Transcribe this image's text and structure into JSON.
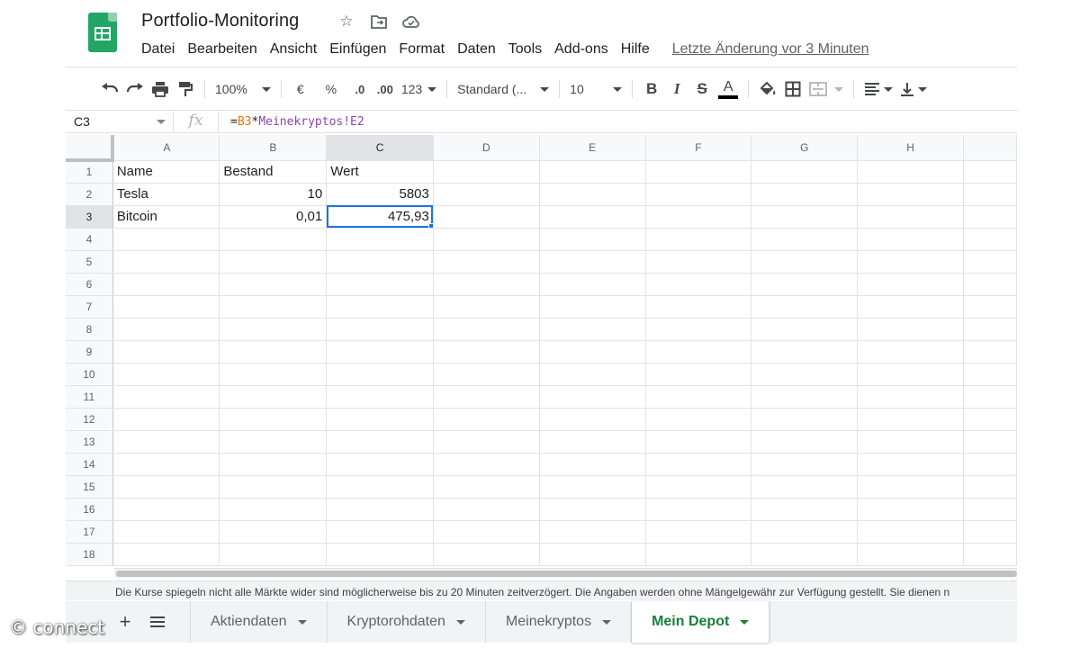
{
  "app": {
    "doc_title": "Portfolio-Monitoring",
    "last_edit": "Letzte Änderung vor 3 Minuten",
    "brand_color": "#188038",
    "logo_color": "#23a566"
  },
  "title_icons": [
    "star-icon",
    "move-to-folder-icon",
    "cloud-status-icon"
  ],
  "menu": [
    "Datei",
    "Bearbeiten",
    "Ansicht",
    "Einfügen",
    "Format",
    "Daten",
    "Tools",
    "Add-ons",
    "Hilfe"
  ],
  "toolbar": {
    "zoom": "100%",
    "currency": "€",
    "percent": "%",
    "decrease_decimals": ".0",
    "increase_decimals": ".00",
    "more_formats": "123",
    "font_name": "Standard (...",
    "font_size": "10",
    "bold": "B",
    "italic": "I",
    "strikethrough": "S",
    "text_color": "A"
  },
  "formula_bar": {
    "cell_ref": "C3",
    "fx": "fx",
    "formula_prefix": "=",
    "formula_ref1": "B3",
    "formula_op": "*",
    "formula_ref2": "Meinekryptos!E2"
  },
  "sheet": {
    "columns": [
      "A",
      "B",
      "C",
      "D",
      "E",
      "F",
      "G",
      "H"
    ],
    "active_column": "C",
    "active_row": 3,
    "rows": [
      {
        "n": "1",
        "cells": [
          "Name",
          "Bestand",
          "Wert",
          "",
          "",
          "",
          "",
          ""
        ]
      },
      {
        "n": "2",
        "cells": [
          "Tesla",
          "10",
          "5803",
          "",
          "",
          "",
          "",
          ""
        ]
      },
      {
        "n": "3",
        "cells": [
          "Bitcoin",
          "0,01",
          "475,93",
          "",
          "",
          "",
          "",
          ""
        ]
      },
      {
        "n": "4",
        "cells": [
          "",
          "",
          "",
          "",
          "",
          "",
          "",
          ""
        ]
      },
      {
        "n": "5",
        "cells": [
          "",
          "",
          "",
          "",
          "",
          "",
          "",
          ""
        ]
      },
      {
        "n": "6",
        "cells": [
          "",
          "",
          "",
          "",
          "",
          "",
          "",
          ""
        ]
      },
      {
        "n": "7",
        "cells": [
          "",
          "",
          "",
          "",
          "",
          "",
          "",
          ""
        ]
      },
      {
        "n": "8",
        "cells": [
          "",
          "",
          "",
          "",
          "",
          "",
          "",
          ""
        ]
      },
      {
        "n": "9",
        "cells": [
          "",
          "",
          "",
          "",
          "",
          "",
          "",
          ""
        ]
      },
      {
        "n": "10",
        "cells": [
          "",
          "",
          "",
          "",
          "",
          "",
          "",
          ""
        ]
      },
      {
        "n": "11",
        "cells": [
          "",
          "",
          "",
          "",
          "",
          "",
          "",
          ""
        ]
      },
      {
        "n": "12",
        "cells": [
          "",
          "",
          "",
          "",
          "",
          "",
          "",
          ""
        ]
      },
      {
        "n": "13",
        "cells": [
          "",
          "",
          "",
          "",
          "",
          "",
          "",
          ""
        ]
      },
      {
        "n": "14",
        "cells": [
          "",
          "",
          "",
          "",
          "",
          "",
          "",
          ""
        ]
      },
      {
        "n": "15",
        "cells": [
          "",
          "",
          "",
          "",
          "",
          "",
          "",
          ""
        ]
      },
      {
        "n": "16",
        "cells": [
          "",
          "",
          "",
          "",
          "",
          "",
          "",
          ""
        ]
      },
      {
        "n": "17",
        "cells": [
          "",
          "",
          "",
          "",
          "",
          "",
          "",
          ""
        ]
      },
      {
        "n": "18",
        "cells": [
          "",
          "",
          "",
          "",
          "",
          "",
          "",
          ""
        ]
      }
    ],
    "numeric_columns": [
      "B",
      "C"
    ]
  },
  "disclaimer": "Die Kurse spiegeln nicht alle Märkte wider sind möglicherweise bis zu 20 Minuten zeitverzögert. Die Angaben werden ohne Mängelgewähr zur Verfügung gestellt. Sie dienen n",
  "tabs": [
    {
      "label": "Aktiendaten",
      "active": false
    },
    {
      "label": "Kryptorohdaten",
      "active": false
    },
    {
      "label": "Meinekryptos",
      "active": false
    },
    {
      "label": "Mein Depot",
      "active": true
    }
  ],
  "watermark": "© connect"
}
